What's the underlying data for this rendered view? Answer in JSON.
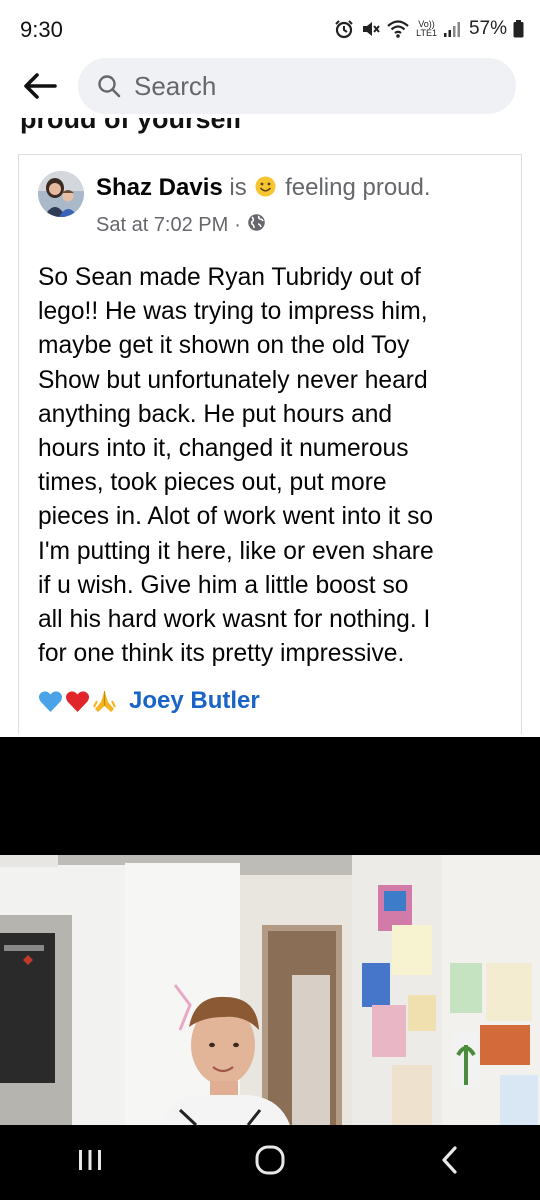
{
  "status_bar": {
    "time": "9:30",
    "network_label": "Vo))\nLTE1",
    "battery": "57%",
    "icons": [
      "alarm-icon",
      "mute-icon",
      "wifi-icon",
      "signal-icon",
      "battery-icon"
    ]
  },
  "header": {
    "search_placeholder": "Search",
    "back_icon": "arrow-left-icon"
  },
  "cutoff_text": "proud of yourself",
  "post": {
    "author": "Shaz Davis",
    "connector": "is",
    "feeling": "feeling proud.",
    "timestamp": "Sat at 7:02 PM",
    "separator": "·",
    "audience_icon": "globe-icon",
    "body": "So Sean made Ryan Tubridy out of\nlego!! He was trying to impress him,\nmaybe get it shown on the old Toy\nShow but unfortunately never heard\nanything back. He put hours and\nhours into it, changed it numerous\ntimes, took pieces out, put more\npieces in. Alot of work went into it so\nI'm putting it here, like or even share\nif u wish. Give him a little boost so\nall his hard work wasnt for nothing. I\nfor one  think its pretty impressive.",
    "tagged": "Joey Butler",
    "emojis": [
      "blue-heart-icon",
      "red-heart-icon",
      "praying-hands-icon"
    ]
  },
  "nav_bar": {
    "icons": [
      "recent-apps-icon",
      "home-icon",
      "back-icon"
    ]
  },
  "colors": {
    "link": "#1a64c7",
    "secondary_text": "#65676b",
    "search_bg": "#eff1f4"
  }
}
